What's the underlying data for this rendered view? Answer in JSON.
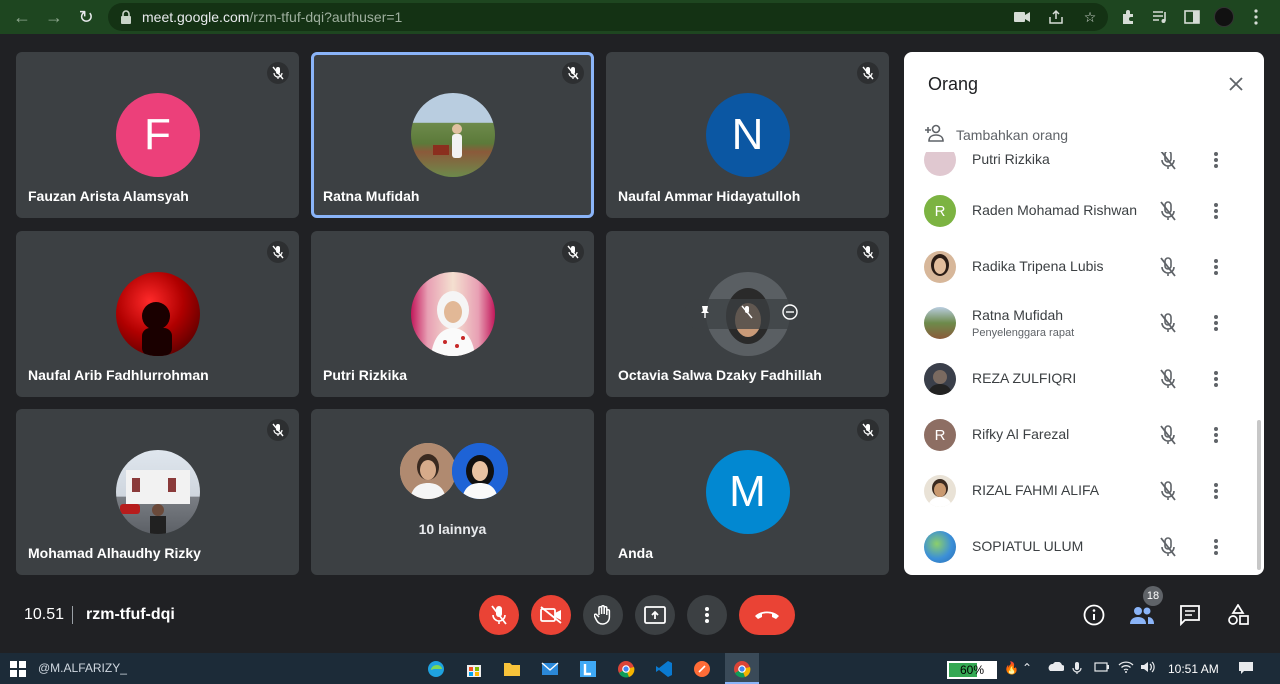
{
  "browser": {
    "url_host": "meet.google.com",
    "url_path": "/rzm-tfuf-dqi?authuser=1"
  },
  "tiles": [
    {
      "name": "Fauzan Arista Alamsyah",
      "initial": "F",
      "color": "#ec407a"
    },
    {
      "name": "Ratna Mufidah"
    },
    {
      "name": "Naufal Ammar Hidayatulloh",
      "initial": "N",
      "color": "#0b57a3"
    },
    {
      "name": "Naufal Arib Fadhlurrohman"
    },
    {
      "name": "Putri Rizkika"
    },
    {
      "name": "Octavia Salwa Dzaky Fadhillah"
    },
    {
      "name": "Mohamad Alhaudhy Rizky"
    },
    {
      "more_label": "10 lainnya"
    },
    {
      "name": "Anda",
      "initial": "M",
      "color": "#0288d1"
    }
  ],
  "people_panel": {
    "title": "Orang",
    "add_label": "Tambahkan orang",
    "participants": [
      {
        "name": "Putri Rizkika",
        "avatar": "photo"
      },
      {
        "name": "Raden Mohamad Rishwan",
        "initial": "R",
        "color": "#7cb342"
      },
      {
        "name": "Radika Tripena Lubis",
        "avatar": "photo"
      },
      {
        "name": "Ratna Mufidah",
        "role": "Penyelenggara rapat",
        "avatar": "photo"
      },
      {
        "name": "REZA ZULFIQRI",
        "avatar": "photo"
      },
      {
        "name": "Rifky Al Farezal",
        "initial": "R",
        "color": "#8d6e63"
      },
      {
        "name": "RIZAL FAHMI ALIFA",
        "avatar": "photo"
      },
      {
        "name": "SOPIATUL ULUM",
        "avatar": "photo"
      }
    ]
  },
  "bottom_bar": {
    "time": "10.51",
    "meeting_code": "rzm-tfuf-dqi",
    "people_count": "18"
  },
  "taskbar": {
    "user": "@M.ALFARIZY_",
    "battery": "60%",
    "battery_level": 0.6,
    "clock": "10:51 AM"
  }
}
